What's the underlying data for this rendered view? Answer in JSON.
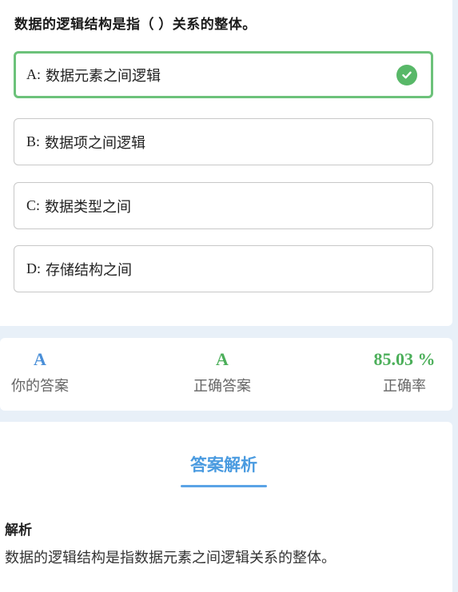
{
  "question": {
    "title": "数据的逻辑结构是指（ ）关系的整体。",
    "options": [
      {
        "key": "A:",
        "text": "数据元素之间逻辑",
        "correct": true
      },
      {
        "key": "B:",
        "text": "数据项之间逻辑",
        "correct": false
      },
      {
        "key": "C:",
        "text": "数据类型之间",
        "correct": false
      },
      {
        "key": "D:",
        "text": "存储结构之间",
        "correct": false
      }
    ]
  },
  "stats": {
    "your_answer": {
      "value": "A",
      "label": "你的答案"
    },
    "correct_answer": {
      "value": "A",
      "label": "正确答案"
    },
    "accuracy": {
      "value": "85.03 %",
      "label": "正确率"
    }
  },
  "analysis": {
    "heading": "答案解析",
    "label": "解析",
    "text": "数据的逻辑结构是指数据元素之间逻辑关系的整体。"
  },
  "colors": {
    "correct_green": "#58b868",
    "accent_blue": "#4a9be0",
    "background": "#e8f0f8"
  },
  "icons": {
    "correct_option": "check-circle-icon"
  }
}
